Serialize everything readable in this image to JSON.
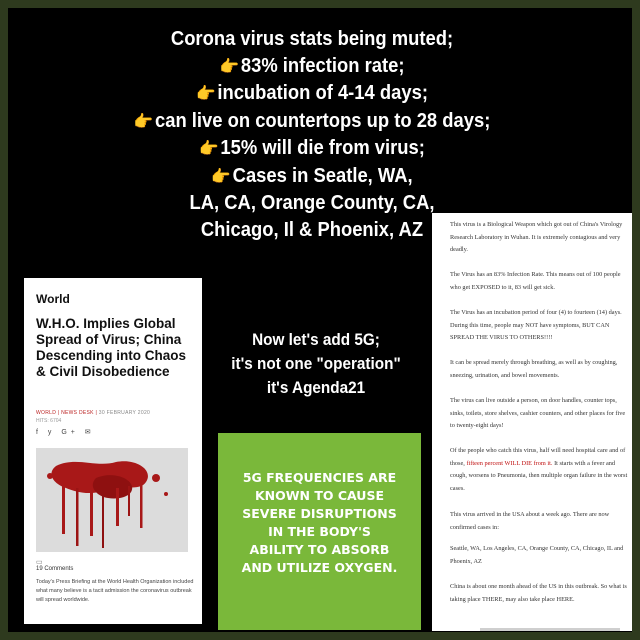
{
  "headline": {
    "lines": [
      "Corona virus stats being muted;",
      "83% infection rate;",
      "incubation of 4-14 days;",
      "can live on countertops up to 28 days;",
      "15% will die from virus;",
      "Cases in Seatle, WA,",
      "LA, CA, Orange County, CA,",
      "Chicago, Il & Phoenix, AZ"
    ],
    "pointer": "👉"
  },
  "article": {
    "section": "World",
    "title": "W.H.O. Implies Global Spread of Virus; China Descending into Chaos & Civil Disobedience",
    "meta_cat": "WORLD | NEWS DESK |",
    "meta_date": "30 FEBRUARY 2020",
    "meta_hits": "HITS: 6704",
    "social": "f  y  G+  ✉",
    "comments": "19 Comments",
    "body": "Today's Press Briefing at the World Health Organization included what many believe is a tacit admission the coronavirus outbreak will spread worldwide."
  },
  "midtext": [
    "Now let's add 5G;",
    "it's not one \"operation\"",
    "it's Agenda21"
  ],
  "greenbox": [
    "5G FREQUENCIES ARE",
    "KNOWN TO CAUSE",
    "SEVERE DISRUPTIONS",
    "IN THE BODY'S",
    "ABILITY TO ABSORB",
    "AND UTILIZE OXYGEN."
  ],
  "doc": {
    "p1": "This virus is a Biological Weapon which got out of China's Virology Research Laboratory in Wuhan. It is extremely contagious and very deadly.",
    "p2": "The Virus has an 83% Infection Rate. This means out of 100 people who get EXPOSED to it, 83 will get sick.",
    "p3": "The Virus has an incubation period of four (4) to fourteen (14) days. During this time, people may NOT have symptoms, BUT CAN SPREAD THE VIRUS TO OTHERS!!!!",
    "p4": "It can be spread merely through breathing, as well as by coughing, sneezing, urination, and bowel movements.",
    "p5": "The virus can live outside a person, on door handles, counter tops, sinks, toilets, store shelves, cashier counters, and other places for five to twenty-eight days!",
    "p6a": "Of the people who catch this virus, half will need hospital care and of those,",
    "p6red": "fifteen percent WILL DIE from it.",
    "p6b": "It starts with a fever and cough, worsens to Pneumonia, then multiple organ failure in the worst cases.",
    "p7": "This virus arrived in the USA about a week ago. There are now confirmed cases in:",
    "p8": "Seattle, WA, Los Angeles, CA, Orange County, CA, Chicago, IL and Phoenix, AZ",
    "p9": "China is about one month ahead of the US in this outbreak. So what is taking place THERE, may also take place HERE."
  },
  "colors": {
    "background": "#000000",
    "border": "#2e3a1e",
    "green_box": "#7ab83a",
    "warning_red": "#c01010"
  }
}
